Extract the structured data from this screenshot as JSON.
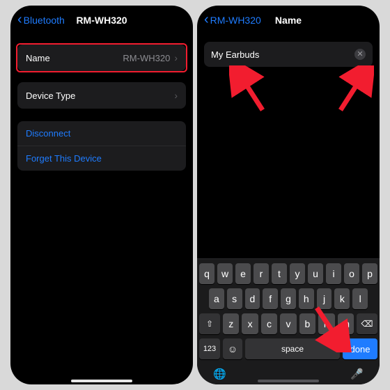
{
  "left": {
    "back_label": "Bluetooth",
    "title": "RM-WH320",
    "name_row": {
      "label": "Name",
      "value": "RM-WH320"
    },
    "device_type_label": "Device Type",
    "disconnect_label": "Disconnect",
    "forget_label": "Forget This Device"
  },
  "right": {
    "back_label": "RM-WH320",
    "title": "Name",
    "input_value": "My Earbuds"
  },
  "keyboard": {
    "row1": [
      "q",
      "w",
      "e",
      "r",
      "t",
      "y",
      "u",
      "i",
      "o",
      "p"
    ],
    "row2": [
      "a",
      "s",
      "d",
      "f",
      "g",
      "h",
      "j",
      "k",
      "l"
    ],
    "row3": [
      "z",
      "x",
      "c",
      "v",
      "b",
      "n",
      "m"
    ],
    "num_label": "123",
    "space_label": "space",
    "done_label": "done"
  }
}
